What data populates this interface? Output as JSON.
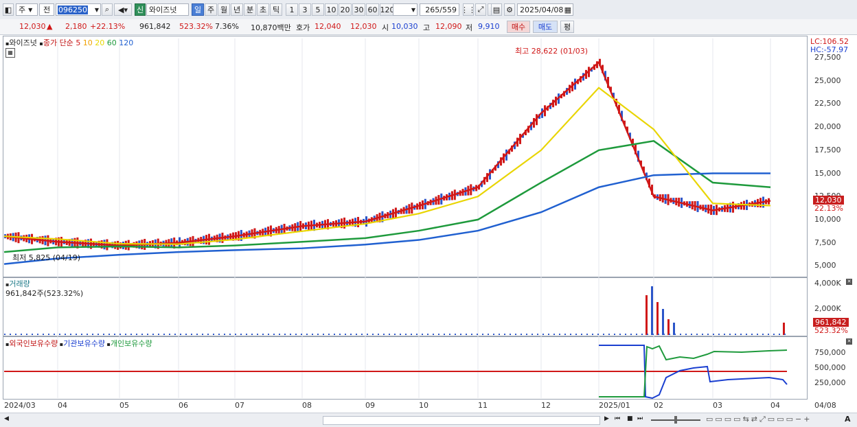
{
  "toolbar": {
    "type1": "주",
    "type2": "전",
    "code": "096250",
    "new_badge": "신",
    "name": "와이즈넛",
    "periods": [
      "일",
      "주",
      "월",
      "년",
      "분",
      "초",
      "틱"
    ],
    "nums": [
      "1",
      "3",
      "5",
      "10",
      "20",
      "30",
      "60",
      "120"
    ],
    "count": "265",
    "count_total": "/559",
    "date": "2025/04/08"
  },
  "info": {
    "price": "12,030",
    "change": "2,180",
    "change_pct": "+22.13%",
    "volume": "961,842",
    "volume_pct": "523.32%",
    "turnover_pct": "7.36%",
    "amount": "10,870백만",
    "ask_label": "호가",
    "ask": "12,040",
    "bid": "12,030",
    "open_label": "시",
    "open": "10,030",
    "high_label": "고",
    "high": "12,090",
    "low_label": "저",
    "low": "9,910",
    "buy": "매수",
    "sell": "매도",
    "flat": "평"
  },
  "price_panel": {
    "legend_name": "와이즈넛",
    "legend_close": "종가 단순",
    "ma": [
      "5",
      "10",
      "20",
      "60",
      "120"
    ],
    "ma_colors": [
      "#d01818",
      "#f0a000",
      "#e8d800",
      "#1e9a3c",
      "#2060d0"
    ],
    "high_note": "최고 28,622 (01/03)",
    "low_note": "최저 5,825 (04/19)",
    "lc": "LC:106.52",
    "hc": "HC:-57.97",
    "y_ticks": [
      "27,500",
      "25,000",
      "22,500",
      "20,000",
      "17,500",
      "15,000",
      "12,500",
      "10,000",
      "7,500",
      "5,000"
    ],
    "last_price": "12,030",
    "last_pct": "22.13%"
  },
  "volume_panel": {
    "title": "거래량",
    "value": "961,842주(523.32%)",
    "y_ticks": [
      "4,000K",
      "2,000K"
    ],
    "last": "961,842",
    "last_pct": "523.32%"
  },
  "holding_panel": {
    "legend": [
      "외국인보유수량",
      "기관보유수량",
      "개인보유수량"
    ],
    "y_ticks": [
      "750,000",
      "500,000",
      "250,000"
    ]
  },
  "x_labels": [
    "2024/03",
    "04",
    "05",
    "06",
    "07",
    "08",
    "09",
    "10",
    "11",
    "12",
    "2025/01",
    "02",
    "03",
    "04"
  ],
  "x_right": "04/08",
  "chart_data": {
    "type": "line",
    "title": "",
    "ylim": [
      4000,
      29000
    ],
    "x": [
      "2024/03",
      "2024/04",
      "2024/05",
      "2024/06",
      "2024/07",
      "2024/08",
      "2024/09",
      "2024/10",
      "2024/11",
      "2024/12",
      "2025/01",
      "2025/02",
      "2025/03",
      "2025/04"
    ],
    "series": [
      {
        "values": [
          8200,
          7600,
          7200,
          7500,
          8200,
          9300,
          9800,
          11500,
          13500,
          21500,
          27000,
          12500,
          11000,
          12030
        ]
      },
      {
        "name": "60",
        "values": [
          6500,
          7000,
          7100,
          7000,
          7200,
          7600,
          8000,
          8800,
          10000,
          14000,
          17500,
          18500,
          14000,
          13500
        ]
      },
      {
        "name": "120",
        "values": [
          5200,
          5800,
          6200,
          6500,
          6700,
          6900,
          7300,
          7800,
          8800,
          10800,
          13500,
          14800,
          15000,
          15000
        ]
      }
    ]
  }
}
